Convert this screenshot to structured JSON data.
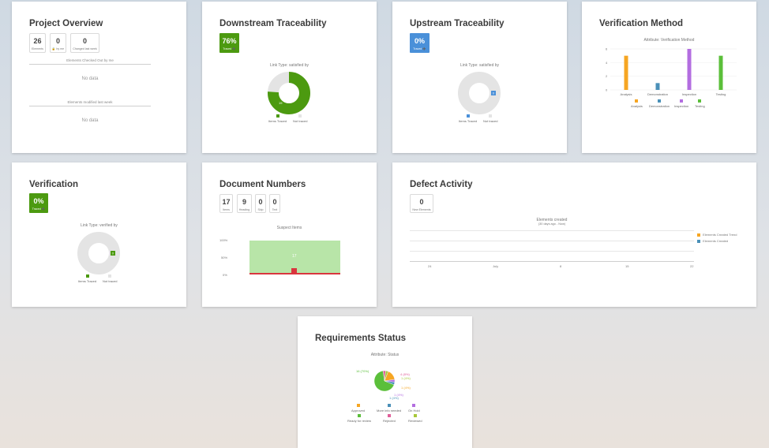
{
  "colors": {
    "green": "#4c9a10",
    "blue": "#4a90d9",
    "ring_grey": "#e4e4e4",
    "orange": "#f6a623",
    "teal": "#4a90b8",
    "purple": "#b36ee0",
    "lime": "#5bbf3a",
    "red": "#d9363e",
    "light_green": "#b8e5a8"
  },
  "project_overview": {
    "title": "Project Overview",
    "stats": [
      {
        "value": "26",
        "label": "Elements"
      },
      {
        "value": "0",
        "label": "🔒 by me"
      },
      {
        "value": "0",
        "label": "Changed last week"
      }
    ],
    "section1": "Elements Checked Out by me",
    "nodata1": "No data",
    "section2": "Elements modified last week",
    "nodata2": "No data"
  },
  "downstream": {
    "title": "Downstream Traceability",
    "badge_value": "76%",
    "badge_label": "Traced ➕",
    "link_type": "Link Type:  satisfied by",
    "traced_value": "19",
    "legend": [
      "Items Traced",
      "Not traced"
    ]
  },
  "upstream": {
    "title": "Upstream Traceability",
    "badge_value": "0%",
    "badge_label": "Traced ➕",
    "link_type": "Link Type:  satisfied by",
    "traced_value": "0",
    "legend": [
      "Items Traced",
      "Not traced"
    ]
  },
  "verification_method": {
    "title": "Verification Method",
    "chart_caption": "Attribute:  Verification Method",
    "legend": [
      "Analysis",
      "Demonstration",
      "Inspection",
      "Testing"
    ]
  },
  "verification": {
    "title": "Verification",
    "badge_value": "0%",
    "badge_label": "Traced ➕",
    "link_type": "Link Type:  verified by",
    "traced_value": "0",
    "legend": [
      "Items Traced",
      "Not traced"
    ]
  },
  "document_numbers": {
    "title": "Document Numbers",
    "stats": [
      {
        "value": "17",
        "label": "Items"
      },
      {
        "value": "9",
        "label": "Heading"
      },
      {
        "value": "0",
        "label": "Skip"
      },
      {
        "value": "0",
        "label": "Text"
      }
    ],
    "chart_caption": "Suspect Items",
    "y_ticks": [
      "100%",
      "50%",
      "0%"
    ],
    "big_value": "17",
    "small_value": "1"
  },
  "defect_activity": {
    "title": "Defect Activity",
    "stat_value": "0",
    "stat_label": "New Elements",
    "chart_caption": "Elements created",
    "chart_sub": "(30 days ago - Now)",
    "x_ticks": [
      "24",
      "July",
      "8",
      "15",
      "22"
    ],
    "legend": [
      "Elements Created Trend",
      "Elements Created"
    ]
  },
  "requirements_status": {
    "title": "Requirements Status",
    "chart_caption": "Attribute:  Status",
    "labels": [
      "16 (70%)",
      "4 (8%)",
      "1 (4%)",
      "1 (4%)",
      "1 (4%)",
      "1 (4%)"
    ],
    "legend": [
      "Approved",
      "More info needed",
      "On Hold",
      "Ready for review",
      "Rejected",
      "Reviewed"
    ]
  },
  "chart_data": [
    {
      "type": "pie",
      "title": "Downstream Traceability",
      "categories": [
        "Items Traced",
        "Not traced"
      ],
      "values": [
        76,
        24
      ]
    },
    {
      "type": "pie",
      "title": "Upstream Traceability",
      "categories": [
        "Items Traced",
        "Not traced"
      ],
      "values": [
        0,
        100
      ]
    },
    {
      "type": "bar",
      "title": "Attribute:  Verification Method",
      "categories": [
        "Analysis",
        "Demonstration",
        "Inspection",
        "Testing"
      ],
      "values": [
        5,
        1,
        6,
        5
      ],
      "ylim": [
        0,
        6
      ],
      "y_ticks": [
        0,
        2,
        4,
        6
      ]
    },
    {
      "type": "pie",
      "title": "Verification",
      "categories": [
        "Items Traced",
        "Not traced"
      ],
      "values": [
        0,
        100
      ]
    },
    {
      "type": "bar",
      "title": "Suspect Items",
      "categories": [
        "Items"
      ],
      "series": [
        {
          "name": "not suspect",
          "values": [
            17
          ]
        },
        {
          "name": "suspect",
          "values": [
            1
          ]
        }
      ]
    },
    {
      "type": "pie",
      "title": "Attribute:  Status",
      "categories": [
        "Approved",
        "More info needed",
        "On Hold",
        "Ready for review",
        "Rejected",
        "Reviewed"
      ],
      "values": [
        4,
        1,
        1,
        16,
        1,
        1
      ]
    }
  ]
}
